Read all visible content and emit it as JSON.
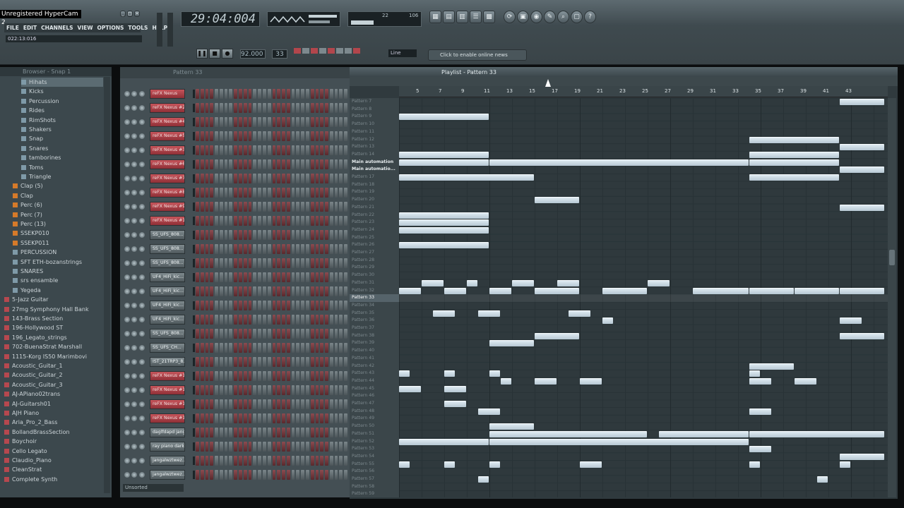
{
  "app": {
    "hypercam_label": "Unregistered HyperCam 2",
    "menu": [
      "FILE",
      "EDIT",
      "CHANNELS",
      "VIEW",
      "OPTIONS",
      "TOOLS",
      "HELP"
    ],
    "hint_time": "022:13:016",
    "song_time": "29:04:004",
    "tempo": "92.000",
    "pattern_number": "33",
    "snap_mode": "Line",
    "online_news": "Click to enable online news",
    "cpu_readout": "22",
    "poly_readout": "106"
  },
  "browser": {
    "title": "Browser - Snap 1",
    "items": [
      {
        "label": "Hihats",
        "indent": 2,
        "kind": "folder",
        "selected": true
      },
      {
        "label": "Kicks",
        "indent": 2,
        "kind": "folder"
      },
      {
        "label": "Percussion",
        "indent": 2,
        "kind": "folder"
      },
      {
        "label": "Rides",
        "indent": 2,
        "kind": "folder"
      },
      {
        "label": "RimShots",
        "indent": 2,
        "kind": "folder"
      },
      {
        "label": "Shakers",
        "indent": 2,
        "kind": "folder"
      },
      {
        "label": "Snap",
        "indent": 2,
        "kind": "folder"
      },
      {
        "label": "Snares",
        "indent": 2,
        "kind": "folder"
      },
      {
        "label": "tamborines",
        "indent": 2,
        "kind": "folder"
      },
      {
        "label": "Toms",
        "indent": 2,
        "kind": "folder"
      },
      {
        "label": "Triangle",
        "indent": 2,
        "kind": "folder"
      },
      {
        "label": "Clap (5)",
        "indent": 1,
        "kind": "orange"
      },
      {
        "label": "Clap",
        "indent": 1,
        "kind": "orange"
      },
      {
        "label": "Perc (6)",
        "indent": 1,
        "kind": "orange"
      },
      {
        "label": "Perc (7)",
        "indent": 1,
        "kind": "orange"
      },
      {
        "label": "Perc (13)",
        "indent": 1,
        "kind": "orange"
      },
      {
        "label": "SSEKP010",
        "indent": 1,
        "kind": "orange"
      },
      {
        "label": "SSEKP011",
        "indent": 1,
        "kind": "orange"
      },
      {
        "label": "PERCUSSION",
        "indent": 1,
        "kind": "folder"
      },
      {
        "label": "SFT ETH-bozanstrings",
        "indent": 1,
        "kind": "folder"
      },
      {
        "label": "SNARES",
        "indent": 1,
        "kind": "folder"
      },
      {
        "label": "srs ensamble",
        "indent": 1,
        "kind": "folder"
      },
      {
        "label": "Yegeda",
        "indent": 1,
        "kind": "folder"
      },
      {
        "label": "5-Jazz Guitar",
        "indent": 0,
        "kind": "preset"
      },
      {
        "label": "27mg Symphony Hall Bank",
        "indent": 0,
        "kind": "preset"
      },
      {
        "label": "143-Brass Section",
        "indent": 0,
        "kind": "preset"
      },
      {
        "label": "196-Hollywood ST",
        "indent": 0,
        "kind": "preset"
      },
      {
        "label": "196_Legato_strings",
        "indent": 0,
        "kind": "preset"
      },
      {
        "label": "702-BuenaStrat Marshall",
        "indent": 0,
        "kind": "preset"
      },
      {
        "label": "1115-Korg IS50 Marimbovi",
        "indent": 0,
        "kind": "preset"
      },
      {
        "label": "Acoustic_Guitar_1",
        "indent": 0,
        "kind": "preset"
      },
      {
        "label": "Acoustic_Guitar_2",
        "indent": 0,
        "kind": "preset"
      },
      {
        "label": "Acoustic_Guitar_3",
        "indent": 0,
        "kind": "preset"
      },
      {
        "label": "AJ-APiano02trans",
        "indent": 0,
        "kind": "preset"
      },
      {
        "label": "AJ-Guitarsh01",
        "indent": 0,
        "kind": "preset"
      },
      {
        "label": "AJH Piano",
        "indent": 0,
        "kind": "preset"
      },
      {
        "label": "Aria_Pro_2_Bass",
        "indent": 0,
        "kind": "preset"
      },
      {
        "label": "BollandBrassSection",
        "indent": 0,
        "kind": "preset"
      },
      {
        "label": "Boychoir",
        "indent": 0,
        "kind": "preset"
      },
      {
        "label": "Cello Legato",
        "indent": 0,
        "kind": "preset"
      },
      {
        "label": "Claudio_Piano",
        "indent": 0,
        "kind": "preset"
      },
      {
        "label": "CleanStrat",
        "indent": 0,
        "kind": "preset"
      },
      {
        "label": "Complete Synth",
        "indent": 0,
        "kind": "preset"
      }
    ]
  },
  "stepseq": {
    "title": "Pattern 33",
    "filter": "Unsorted",
    "channels": [
      {
        "name": "reFX Nexus",
        "color": "red"
      },
      {
        "name": "reFX Nexus #2",
        "color": "red"
      },
      {
        "name": "reFX Nexus #4",
        "color": "red"
      },
      {
        "name": "reFX Nexus #5",
        "color": "red"
      },
      {
        "name": "reFX Nexus #3",
        "color": "red"
      },
      {
        "name": "reFX Nexus #6",
        "color": "red"
      },
      {
        "name": "reFX Nexus #7",
        "color": "red"
      },
      {
        "name": "reFX Nexus #8",
        "color": "red"
      },
      {
        "name": "reFX Nexus #9",
        "color": "red"
      },
      {
        "name": "reFX Nexus #10",
        "color": "red"
      },
      {
        "name": "SS_UFS_808...",
        "color": "gray"
      },
      {
        "name": "SS_UFS_808...",
        "color": "gray"
      },
      {
        "name": "SS_UFS_808...",
        "color": "gray"
      },
      {
        "name": "UF4_HiFi_kic...",
        "color": "gray"
      },
      {
        "name": "UF4_HiFi_kic...",
        "color": "gray"
      },
      {
        "name": "UF4_HiFi_kic...",
        "color": "gray"
      },
      {
        "name": "UF4_HiFi_kic...",
        "color": "gray"
      },
      {
        "name": "SS_UFS_808...",
        "color": "gray"
      },
      {
        "name": "SS_UFS_CH...",
        "color": "gray"
      },
      {
        "name": "IST_21TRP3_8...",
        "color": "gray"
      },
      {
        "name": "reFX Nexus #11",
        "color": "red"
      },
      {
        "name": "reFX Nexus #12",
        "color": "red"
      },
      {
        "name": "reFX Nexus #13",
        "color": "red"
      },
      {
        "name": "reFX Nexus #14",
        "color": "red"
      },
      {
        "name": "daglfdapd jangal",
        "color": "gray"
      },
      {
        "name": "ray piano dark",
        "color": "gray"
      },
      {
        "name": "jangalwztwez...",
        "color": "gray"
      },
      {
        "name": "jangalwztwez...",
        "color": "gray"
      }
    ]
  },
  "playlist": {
    "title": "Playlist - Pattern 33",
    "ruler": [
      "5",
      "7",
      "9",
      "11",
      "13",
      "15",
      "17",
      "19",
      "21",
      "23",
      "25",
      "27",
      "29",
      "31",
      "33",
      "35",
      "37",
      "39",
      "41",
      "43"
    ],
    "tracks": [
      "Pattern 7",
      "Pattern 8",
      "Pattern 9",
      "Pattern 10",
      "Pattern 11",
      "Pattern 12",
      "Pattern 13",
      "Pattern 14",
      "Main automation",
      "Main automatio...",
      "Pattern 17",
      "Pattern 18",
      "Pattern 19",
      "Pattern 20",
      "Pattern 21",
      "Pattern 22",
      "Pattern 23",
      "Pattern 24",
      "Pattern 25",
      "Pattern 26",
      "Pattern 27",
      "Pattern 28",
      "Pattern 29",
      "Pattern 30",
      "Pattern 31",
      "Pattern 32",
      "Pattern 33",
      "Pattern 34",
      "Pattern 35",
      "Pattern 36",
      "Pattern 37",
      "Pattern 38",
      "Pattern 39",
      "Pattern 40",
      "Pattern 41",
      "Pattern 42",
      "Pattern 43",
      "Pattern 44",
      "Pattern 45",
      "Pattern 46",
      "Pattern 47",
      "Pattern 48",
      "Pattern 49",
      "Pattern 50",
      "Pattern 51",
      "Pattern 52",
      "Pattern 53",
      "Pattern 54",
      "Pattern 55",
      "Pattern 56",
      "Pattern 57",
      "Pattern 58",
      "Pattern 59"
    ],
    "bold_rows": [
      8,
      9
    ],
    "current_row": 26,
    "clips": [
      [
        0,
        39,
        43
      ],
      [
        2,
        0,
        8
      ],
      [
        5,
        31,
        39
      ],
      [
        6,
        39,
        43
      ],
      [
        7,
        0,
        8
      ],
      [
        7,
        31,
        39
      ],
      [
        8,
        0,
        8
      ],
      [
        8,
        8,
        31
      ],
      [
        8,
        31,
        39
      ],
      [
        9,
        39,
        43
      ],
      [
        10,
        0,
        12
      ],
      [
        10,
        31,
        39
      ],
      [
        13,
        12,
        16
      ],
      [
        14,
        39,
        43
      ],
      [
        15,
        0,
        8
      ],
      [
        16,
        0,
        8
      ],
      [
        17,
        0,
        8
      ],
      [
        19,
        0,
        8
      ],
      [
        24,
        2,
        4
      ],
      [
        24,
        6,
        7
      ],
      [
        24,
        10,
        12
      ],
      [
        24,
        14,
        16
      ],
      [
        24,
        22,
        24
      ],
      [
        25,
        0,
        2
      ],
      [
        25,
        4,
        6
      ],
      [
        25,
        8,
        10
      ],
      [
        25,
        12,
        16
      ],
      [
        25,
        18,
        22
      ],
      [
        25,
        26,
        31
      ],
      [
        25,
        31,
        35
      ],
      [
        25,
        35,
        39
      ],
      [
        25,
        39,
        43
      ],
      [
        28,
        3,
        5
      ],
      [
        28,
        7,
        9
      ],
      [
        28,
        15,
        17
      ],
      [
        29,
        18,
        19
      ],
      [
        29,
        39,
        41
      ],
      [
        31,
        12,
        16
      ],
      [
        31,
        39,
        43
      ],
      [
        32,
        8,
        12
      ],
      [
        35,
        31,
        35
      ],
      [
        36,
        0,
        1
      ],
      [
        36,
        4,
        5
      ],
      [
        36,
        8,
        9
      ],
      [
        36,
        31,
        32
      ],
      [
        37,
        9,
        10
      ],
      [
        37,
        12,
        14
      ],
      [
        37,
        16,
        18
      ],
      [
        37,
        31,
        33
      ],
      [
        37,
        35,
        37
      ],
      [
        38,
        0,
        2
      ],
      [
        38,
        4,
        6
      ],
      [
        40,
        4,
        6
      ],
      [
        41,
        7,
        9
      ],
      [
        41,
        31,
        33
      ],
      [
        43,
        8,
        12
      ],
      [
        44,
        8,
        22
      ],
      [
        44,
        23,
        31
      ],
      [
        44,
        31,
        43
      ],
      [
        45,
        0,
        8
      ],
      [
        45,
        8,
        31
      ],
      [
        46,
        31,
        33
      ],
      [
        47,
        39,
        43
      ],
      [
        48,
        0,
        1
      ],
      [
        48,
        4,
        5
      ],
      [
        48,
        8,
        9
      ],
      [
        48,
        16,
        18
      ],
      [
        48,
        31,
        32
      ],
      [
        48,
        39,
        40
      ],
      [
        50,
        7,
        8
      ],
      [
        50,
        37,
        38
      ]
    ]
  }
}
